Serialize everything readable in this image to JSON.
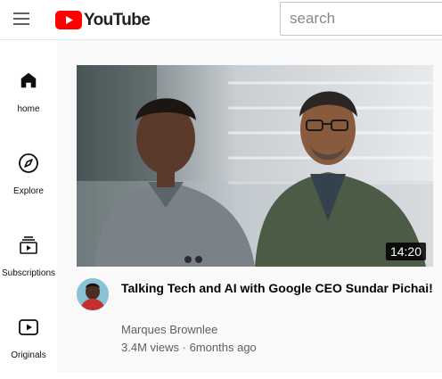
{
  "header": {
    "logo_text": "YouTube",
    "search_placeholder": "search",
    "brand_color": "#ff0000"
  },
  "sidebar": {
    "items": [
      {
        "label": "home",
        "icon": "home-icon"
      },
      {
        "label": "Explore",
        "icon": "compass-icon"
      },
      {
        "label": "Subscriptions",
        "icon": "subscriptions-icon"
      },
      {
        "label": "Originals",
        "icon": "originals-icon"
      }
    ]
  },
  "video": {
    "duration": "14:20",
    "title": "Talking Tech and AI with Google CEO Sundar Pichai!",
    "channel": "Marques Brownlee",
    "views": "3.4M views",
    "separator": "·",
    "age": "6months ago"
  }
}
